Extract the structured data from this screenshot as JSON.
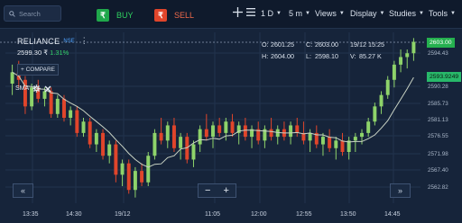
{
  "toolbar": {
    "search_placeholder": "Search",
    "buy_icon": "₹",
    "buy_label": "BUY",
    "sell_icon": "₹",
    "sell_label": "SELL",
    "interval": "1 D",
    "timeframe": "5 m",
    "views": "Views",
    "display": "Display",
    "studies": "Studies",
    "tools": "Tools"
  },
  "instrument": {
    "symbol": "RELIANCE",
    "exchange": "NSE",
    "menu": "⋮",
    "price_text": "2599.30 ₹",
    "change_text": "1.31%"
  },
  "compare_label": "+ COMPARE",
  "study": {
    "label": "SMA"
  },
  "ohlc": {
    "o_key": "O:",
    "o_val": "2601.25",
    "c_key": "C:",
    "c_val": "2603.00",
    "datetime": "19/12 15:25",
    "h_key": "H:",
    "h_val": "2604.00",
    "l_key": "L:",
    "l_val": "2598.10",
    "v_key": "V:",
    "v_val": "85.27 K"
  },
  "price_axis": {
    "current_price": "2603.00",
    "sma_value": "2593.9249",
    "ticks": [
      "2594.43",
      "2590.28",
      "2585.73",
      "2581.13",
      "2576.55",
      "2571.98",
      "2567.40",
      "2562.82"
    ]
  },
  "time_axis": [
    "13:35",
    "14:30",
    "19/12",
    "11:05",
    "12:00",
    "12:55",
    "13:50",
    "14:45"
  ],
  "controls": {
    "scroll_left": "«",
    "zoom_out": "−",
    "zoom_in": "+",
    "scroll_right": "»"
  },
  "colors": {
    "background": "#16243a",
    "up": "#8ed36a",
    "down": "#e0452b",
    "sma": "#c9d3c4",
    "grid": "#22334d"
  },
  "chart_data": {
    "type": "candlestick",
    "ylim": [
      2560.5,
      2605.5
    ],
    "sma_period": null,
    "candles": [
      [
        2592,
        2597,
        2589,
        2595
      ],
      [
        2595,
        2598,
        2591,
        2593
      ],
      [
        2593,
        2594,
        2584,
        2586
      ],
      [
        2586,
        2592,
        2585,
        2591
      ],
      [
        2591,
        2593,
        2587,
        2588
      ],
      [
        2588,
        2591,
        2586,
        2590
      ],
      [
        2590,
        2591,
        2583,
        2584
      ],
      [
        2584,
        2589,
        2583,
        2588
      ],
      [
        2588,
        2589,
        2582,
        2583
      ],
      [
        2583,
        2586,
        2581,
        2585
      ],
      [
        2585,
        2586,
        2578,
        2579
      ],
      [
        2579,
        2583,
        2578,
        2582
      ],
      [
        2582,
        2583,
        2575,
        2576
      ],
      [
        2576,
        2580,
        2574,
        2579
      ],
      [
        2579,
        2580,
        2572,
        2573
      ],
      [
        2573,
        2577,
        2571,
        2576
      ],
      [
        2576,
        2577,
        2566,
        2568
      ],
      [
        2568,
        2572,
        2565,
        2571
      ],
      [
        2571,
        2572,
        2563,
        2564
      ],
      [
        2564,
        2570,
        2562,
        2569
      ],
      [
        2569,
        2571,
        2565,
        2566
      ],
      [
        2566,
        2574,
        2565,
        2573
      ],
      [
        2573,
        2580,
        2572,
        2579
      ],
      [
        2579,
        2583,
        2576,
        2577
      ],
      [
        2577,
        2582,
        2575,
        2581
      ],
      [
        2581,
        2583,
        2574,
        2575
      ],
      [
        2575,
        2579,
        2572,
        2578
      ],
      [
        2578,
        2579,
        2571,
        2572
      ],
      [
        2572,
        2577,
        2570,
        2576
      ],
      [
        2576,
        2581,
        2574,
        2580
      ],
      [
        2580,
        2584,
        2577,
        2578
      ],
      [
        2578,
        2582,
        2575,
        2581
      ],
      [
        2581,
        2583,
        2578,
        2579
      ],
      [
        2579,
        2583,
        2577,
        2582
      ],
      [
        2582,
        2584,
        2578,
        2579
      ],
      [
        2579,
        2582,
        2576,
        2581
      ],
      [
        2581,
        2583,
        2577,
        2578
      ],
      [
        2578,
        2581,
        2575,
        2580
      ],
      [
        2580,
        2582,
        2576,
        2577
      ],
      [
        2577,
        2581,
        2575,
        2580
      ],
      [
        2580,
        2583,
        2577,
        2578
      ],
      [
        2578,
        2581,
        2576,
        2580
      ],
      [
        2580,
        2582,
        2577,
        2578
      ],
      [
        2578,
        2582,
        2576,
        2581
      ],
      [
        2581,
        2583,
        2578,
        2579
      ],
      [
        2579,
        2582,
        2576,
        2577
      ],
      [
        2577,
        2580,
        2574,
        2579
      ],
      [
        2579,
        2581,
        2575,
        2576
      ],
      [
        2576,
        2579,
        2573,
        2578
      ],
      [
        2578,
        2580,
        2574,
        2575
      ],
      [
        2575,
        2578,
        2572,
        2577
      ],
      [
        2577,
        2579,
        2573,
        2574
      ],
      [
        2574,
        2578,
        2572,
        2577
      ],
      [
        2577,
        2579,
        2574,
        2578
      ],
      [
        2578,
        2580,
        2576,
        2579
      ],
      [
        2579,
        2583,
        2578,
        2582
      ],
      [
        2582,
        2587,
        2581,
        2586
      ],
      [
        2586,
        2590,
        2584,
        2589
      ],
      [
        2589,
        2594,
        2588,
        2593
      ],
      [
        2593,
        2598,
        2591,
        2597
      ],
      [
        2597,
        2601,
        2595,
        2599
      ],
      [
        2599,
        2601,
        2596,
        2600
      ],
      [
        2600,
        2604,
        2598,
        2603
      ]
    ]
  }
}
